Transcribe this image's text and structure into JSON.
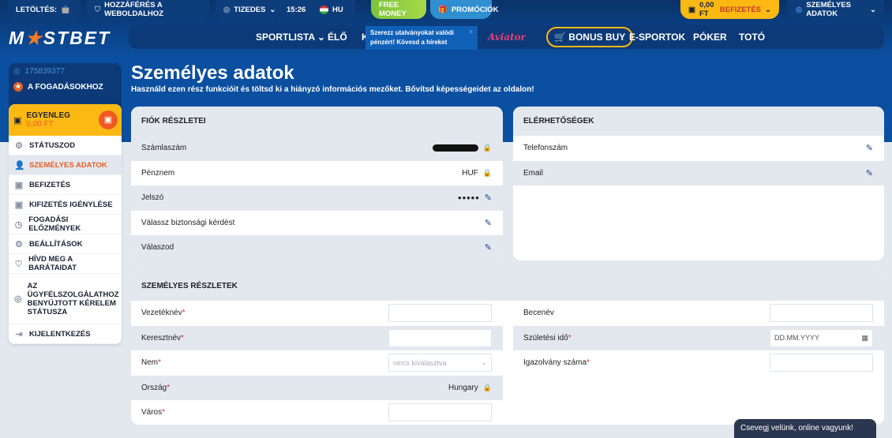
{
  "topbar": {
    "download": "LETÖLTÉS:",
    "access": "HOZZÁFÉRÉS A WEBOLDALHOZ",
    "odds": "TIZEDES",
    "time": "15:26",
    "lang": "HU",
    "free_money": "FREE MONEY",
    "promotions": "PROMÓCIÓK",
    "balance": "0,00 FT",
    "deposit": "BEFIZETÉS",
    "account": "SZEMÉLYES ADATOK"
  },
  "logo": "MOSTBET",
  "nav": {
    "items": [
      "SPORTLISTA",
      "ÉLŐ",
      "K",
      "Aviator",
      "BONUS BUY",
      "E-SPORTOK",
      "PÓKER",
      "TOTÓ"
    ]
  },
  "tooltip": "Szerezz utalványokat valódi pénzért! Kövesd a híreket",
  "sidebar": {
    "user_id": "175839377",
    "to_bets": "A FOGADÁSOKHOZ",
    "balance_label": "EGYENLEG",
    "balance_value": "0,00 FT",
    "items": [
      {
        "label": "STÁTUSZOD",
        "icon": "⚙"
      },
      {
        "label": "SZEMÉLYES ADATOK",
        "icon": "👤"
      },
      {
        "label": "BEFIZETÉS",
        "icon": "▣"
      },
      {
        "label": "KIFIZETÉS IGÉNYLÉSE",
        "icon": "▣"
      },
      {
        "label": "FOGADÁSI ELŐZMÉNYEK",
        "icon": "◷"
      },
      {
        "label": "BEÁLLÍTÁSOK",
        "icon": "⚙"
      },
      {
        "label": "HÍVD MEG A BARÁTAIDAT",
        "icon": "♡"
      },
      {
        "label": "AZ ÜGYFÉLSZOLGÁLATHOZ BENYÚJTOTT KÉRELEM STÁTUSZA",
        "icon": "◎"
      },
      {
        "label": "KIJELENTKEZÉS",
        "icon": "⇥"
      }
    ]
  },
  "page": {
    "title": "Személyes adatok",
    "subtitle": "Használd ezen rész funkcióit és töltsd ki a hiányzó információs mezőket. Bővítsd képességeidet az oldalon!"
  },
  "account_card": {
    "title": "FIÓK RÉSZLETEI",
    "rows": [
      {
        "label": "Számlaszám",
        "value": ""
      },
      {
        "label": "Pénznem",
        "value": "HUF"
      },
      {
        "label": "Jelszó",
        "value": "•••••"
      },
      {
        "label": "Válassz biztonsági kérdést",
        "value": ""
      },
      {
        "label": "Válaszod",
        "value": ""
      }
    ]
  },
  "contact_card": {
    "title": "ELÉRHETŐSÉGEK",
    "rows": [
      {
        "label": "Telefonszám"
      },
      {
        "label": "Email"
      }
    ]
  },
  "personal_card": {
    "title": "SZEMÉLYES RÉSZLETEK",
    "left": [
      {
        "label": "Vezetéknév"
      },
      {
        "label": "Keresztnév"
      },
      {
        "label": "Nem",
        "placeholder": "nincs kiválasztva"
      },
      {
        "label": "Ország",
        "value": "Hungary"
      },
      {
        "label": "Város"
      }
    ],
    "right": [
      {
        "label": "Becenév"
      },
      {
        "label": "Születési idő",
        "placeholder": "DD.MM.YYYY"
      },
      {
        "label": "Igazolvány száma"
      }
    ]
  },
  "chat": "Csevegj velünk, online vagyunk!",
  "colors": {
    "accent": "#e85d24",
    "yellow": "#fdb913",
    "blue": "#0b4fa0"
  }
}
